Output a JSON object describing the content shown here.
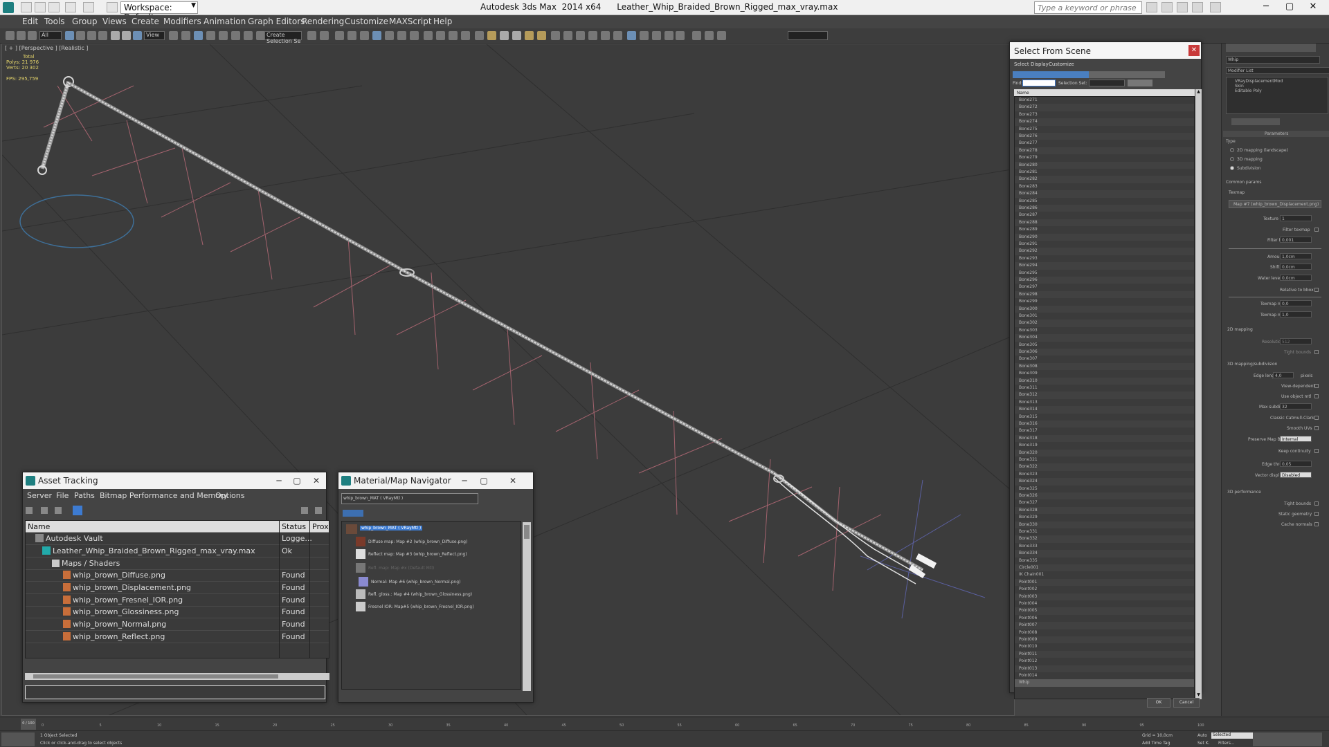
{
  "titlebar": {
    "title": "Autodesk 3ds Max  2014 x64      Leather_Whip_Braided_Brown_Rigged_max_vray.max",
    "workspace": "Workspace: Default",
    "search_placeholder": "Type a keyword or phrase"
  },
  "menubar": {
    "items": [
      "Edit",
      "Tools",
      "Group",
      "Views",
      "Create",
      "Modifiers",
      "Animation",
      "Graph Editors",
      "Rendering",
      "Customize",
      "MAXScript",
      "Help"
    ]
  },
  "toolbar": {
    "selection_filter": "All",
    "ref_coord": "View",
    "named_selection": "Create Selection Se"
  },
  "viewport": {
    "label": "[ + ] [Perspective ] [Realistic ]",
    "stats_total": "Total",
    "stats_polys_label": "Polys:",
    "stats_polys": "21 976",
    "stats_verts_label": "Verts:",
    "stats_verts": "20 302",
    "stats_fps_label": "FPS:",
    "stats_fps": "295,759"
  },
  "asset_tracking": {
    "title": "Asset Tracking",
    "menu": [
      "Server",
      "File",
      "Paths",
      "Bitmap Performance and Memory",
      "Options"
    ],
    "columns": [
      "Name",
      "Status",
      "Prox"
    ],
    "rows": [
      {
        "name": "Autodesk Vault",
        "status": "Logge..."
      },
      {
        "name": "Leather_Whip_Braided_Brown_Rigged_max_vray.max",
        "status": "Ok"
      },
      {
        "name": "Maps / Shaders",
        "status": ""
      },
      {
        "name": "whip_brown_Diffuse.png",
        "status": "Found"
      },
      {
        "name": "whip_brown_Displacement.png",
        "status": "Found"
      },
      {
        "name": "whip_brown_Fresnel_IOR.png",
        "status": "Found"
      },
      {
        "name": "whip_brown_Glossiness.png",
        "status": "Found"
      },
      {
        "name": "whip_brown_Normal.png",
        "status": "Found"
      },
      {
        "name": "whip_brown_Reflect.png",
        "status": "Found"
      }
    ]
  },
  "material_navigator": {
    "title": "Material/Map Navigator",
    "current": "whip_brown_MAT  ( VRayMtl )",
    "items": [
      "whip_brown_MAT  ( VRayMtl )",
      "Diffuse map: Map #2 (whip_brown_Diffuse.png)",
      "Reflect map: Map #3 (whip_brown_Reflect.png)",
      "Refl. map: Map #x (Default Mtl)",
      "Normal: Map #6 (whip_brown_Normal.png)",
      "Refl. gloss.: Map #4 (whip_brown_Glossiness.png)",
      "Fresnel IOR: Map#5 (whip_brown_Fresnel_IOR.png)"
    ]
  },
  "select_from_scene": {
    "title": "Select From Scene",
    "menu": [
      "Select",
      "Display",
      "Customize"
    ],
    "find_label": "Find:",
    "selection_set_label": "Selection Set:",
    "column": "Name",
    "items": [
      "Bone271",
      "Bone272",
      "Bone273",
      "Bone274",
      "Bone275",
      "Bone276",
      "Bone277",
      "Bone278",
      "Bone279",
      "Bone280",
      "Bone281",
      "Bone282",
      "Bone283",
      "Bone284",
      "Bone285",
      "Bone286",
      "Bone287",
      "Bone288",
      "Bone289",
      "Bone290",
      "Bone291",
      "Bone292",
      "Bone293",
      "Bone294",
      "Bone295",
      "Bone296",
      "Bone297",
      "Bone298",
      "Bone299",
      "Bone300",
      "Bone301",
      "Bone302",
      "Bone303",
      "Bone304",
      "Bone305",
      "Bone306",
      "Bone307",
      "Bone308",
      "Bone309",
      "Bone310",
      "Bone311",
      "Bone312",
      "Bone313",
      "Bone314",
      "Bone315",
      "Bone316",
      "Bone317",
      "Bone318",
      "Bone319",
      "Bone320",
      "Bone321",
      "Bone322",
      "Bone323",
      "Bone324",
      "Bone325",
      "Bone326",
      "Bone327",
      "Bone328",
      "Bone329",
      "Bone330",
      "Bone331",
      "Bone332",
      "Bone333",
      "Bone334",
      "Bone335",
      "Circle001",
      "IK Chain001",
      "Point001",
      "Point002",
      "Point003",
      "Point004",
      "Point005",
      "Point006",
      "Point007",
      "Point008",
      "Point009",
      "Point010",
      "Point011",
      "Point012",
      "Point013",
      "Point014",
      "Whip"
    ],
    "ok": "OK",
    "cancel": "Cancel"
  },
  "command_panel": {
    "object_name": "Whip",
    "modifier_list": "Modifier List",
    "stack": [
      "VRayDisplacementMod",
      "Skin",
      "Editable Poly"
    ],
    "rollout_parameters": "Parameters",
    "type_label": "Type",
    "type_options": [
      "2D mapping (landscape)",
      "3D mapping",
      "Subdivision"
    ],
    "common_params": "Common params",
    "texmap_label": "Texmap",
    "texmap_value": "Map #7 (whip_brown_Displacement.png)",
    "texture_chan_label": "Texture chan",
    "texture_chan": "1",
    "filter_texmap": "Filter texmap",
    "filter_blur_label": "Filter blur",
    "filter_blur": "0,001",
    "amount_label": "Amount",
    "amount": "1,0cm",
    "shift_label": "Shift",
    "shift": "0,0cm",
    "water_level_label": "Water level",
    "water_level": "0,0cm",
    "relative_bbox": "Relative to bbox",
    "texmap_min_label": "Texmap min",
    "texmap_min": "0,0",
    "texmap_max_label": "Texmap max",
    "texmap_max": "1,0",
    "section_2d": "2D mapping",
    "resolution_label": "Resolution",
    "resolution": "512",
    "tight_bounds": "Tight bounds",
    "section_3d": "3D mapping/subdivision",
    "edge_length_label": "Edge length",
    "edge_length": "4,0",
    "pixels": "pixels",
    "view_dependent": "View-dependent",
    "use_object_mtl": "Use object mtl",
    "max_subdivs_label": "Max subdivs",
    "max_subdivs": "32",
    "classic_catmull": "Classic Catmull-Clark",
    "smooth_uvs": "Smooth UVs",
    "preserve_map_bnd_label": "Preserve Map Bnd",
    "preserve_map_bnd": "Internal",
    "keep_continuity": "Keep continuity",
    "edge_thresh_label": "Edge thresh",
    "edge_thresh": "0,05",
    "vector_disp_label": "Vector displ",
    "vector_disp": "Disabled",
    "section_perf": "3D performance",
    "tight_bounds2": "Tight bounds",
    "static_geometry": "Static geometry",
    "cache_normals": "Cache normals"
  },
  "timeline": {
    "frame": "0 / 100",
    "ticks": [
      "0",
      "5",
      "10",
      "15",
      "20",
      "25",
      "30",
      "35",
      "40",
      "45",
      "50",
      "55",
      "60",
      "65",
      "70",
      "75",
      "80",
      "85",
      "90",
      "95",
      "100"
    ]
  },
  "status": {
    "objects_selected": "1 Object Selected",
    "prompt": "Click or click-and-drag to select objects",
    "grid": "Grid = 10,0cm",
    "auto_key": "Auto",
    "selected": "Selected",
    "set_key": "Set K.",
    "filters": "Filters...",
    "add_time_tag": "Add Time Tag"
  }
}
